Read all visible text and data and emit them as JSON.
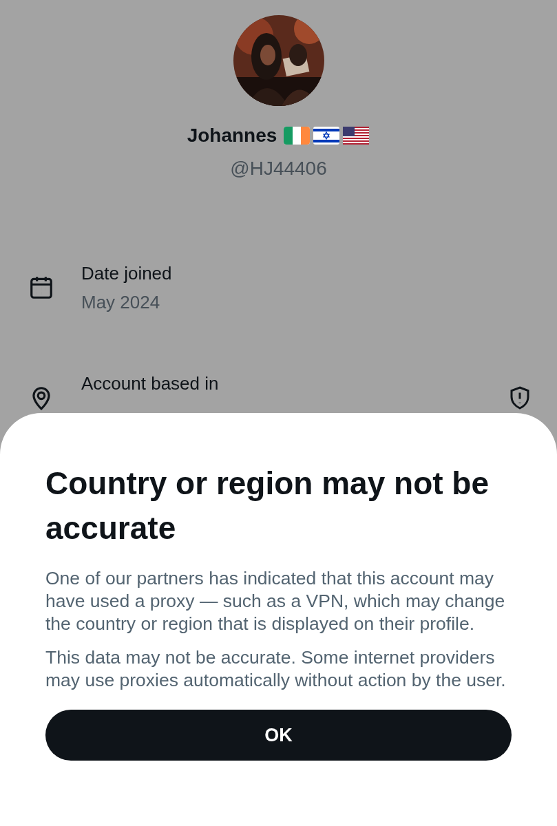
{
  "profile": {
    "name": "Johannes",
    "flags": [
      {
        "kind": "ireland"
      },
      {
        "kind": "israel"
      },
      {
        "kind": "usa"
      }
    ],
    "handle": "@HJ44406"
  },
  "details": [
    {
      "kind": "calendar",
      "label": "Date joined",
      "value": "May 2024",
      "badge": false
    },
    {
      "kind": "location",
      "label": "Account based in",
      "badge": true
    }
  ],
  "sheet": {
    "title": "Country or region may not be accurate",
    "paragraphs": [
      "One of our partners has indicated that this account may have used a proxy — such as a VPN, which may change the country or region that is displayed on their profile.",
      "This data may not be accurate. Some internet providers may use proxies automatically without action by the user."
    ],
    "button": "OK"
  }
}
